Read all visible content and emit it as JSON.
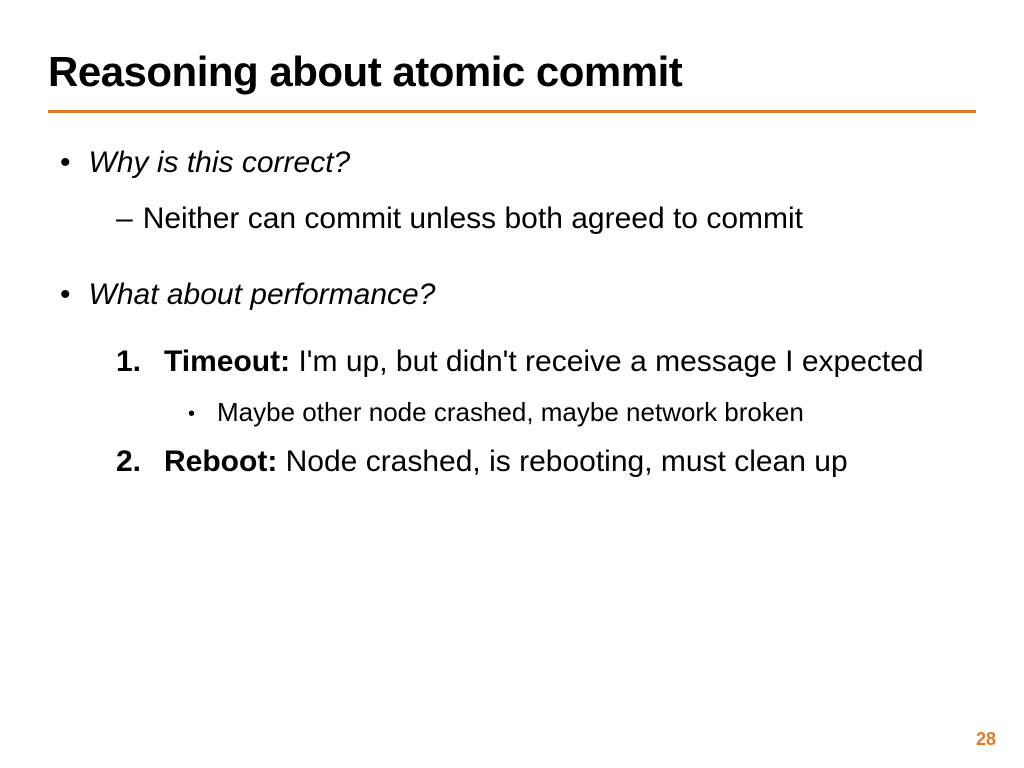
{
  "title": "Reasoning about atomic commit",
  "bullets": {
    "b1": "Why is this correct?",
    "b1_sub": "Neither can commit unless both agreed to commit",
    "b2": "What about performance?",
    "n1_num": "1.",
    "n1_label": "Timeout: ",
    "n1_text": "I'm up, but didn't receive a message I expected",
    "n1_sub": "Maybe other node crashed, maybe network broken",
    "n2_num": "2.",
    "n2_label": "Reboot: ",
    "n2_text": "Node crashed, is rebooting, must clean up"
  },
  "page_number": "28",
  "accent_color": "#e87722"
}
